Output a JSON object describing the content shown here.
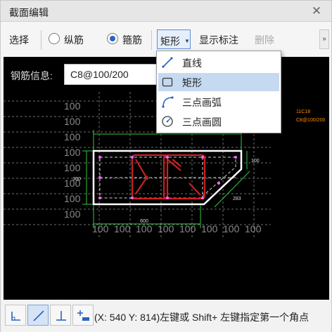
{
  "window": {
    "title": "截面编辑",
    "close_icon": "close-icon"
  },
  "toolbar": {
    "select_label": "选择",
    "longitudinal_label": "纵筋",
    "stirrup_label": "箍筋",
    "stirrup_selected": true,
    "shape_value": "矩形",
    "show_dimension_label": "显示标注",
    "delete_label": "删除",
    "overflow_label": "»"
  },
  "rebar_info": {
    "label": "钢筋信息:",
    "value": "C8@100/200"
  },
  "shape_menu": {
    "items": [
      {
        "label": "直线",
        "icon": "line-icon"
      },
      {
        "label": "矩形",
        "icon": "rectangle-icon",
        "active": true
      },
      {
        "label": "三点画弧",
        "icon": "arc-icon"
      },
      {
        "label": "三点画圆",
        "icon": "circle-icon"
      }
    ]
  },
  "canvas": {
    "dim_top": "900",
    "dim_bottom": "600",
    "dim_left": "300",
    "dim_right": "100",
    "dim_slope": "283",
    "annotation_line1": "11C18",
    "annotation_line2": "C8@100/200",
    "grid_label": "100",
    "colors": {
      "background": "#000000",
      "section": "#ffffff",
      "stirrup": "#cc2020",
      "dimension": "#2ecc40",
      "grid": "#7a7a7a",
      "annotation": "#ff8c00"
    }
  },
  "status": {
    "coord_text": "(X: 540 Y: 814)左键或 Shift+ 左键指定第一个角点",
    "tools": [
      "orthogonal-icon",
      "oblique-icon",
      "perpendicular-icon",
      "add-point-icon"
    ]
  }
}
